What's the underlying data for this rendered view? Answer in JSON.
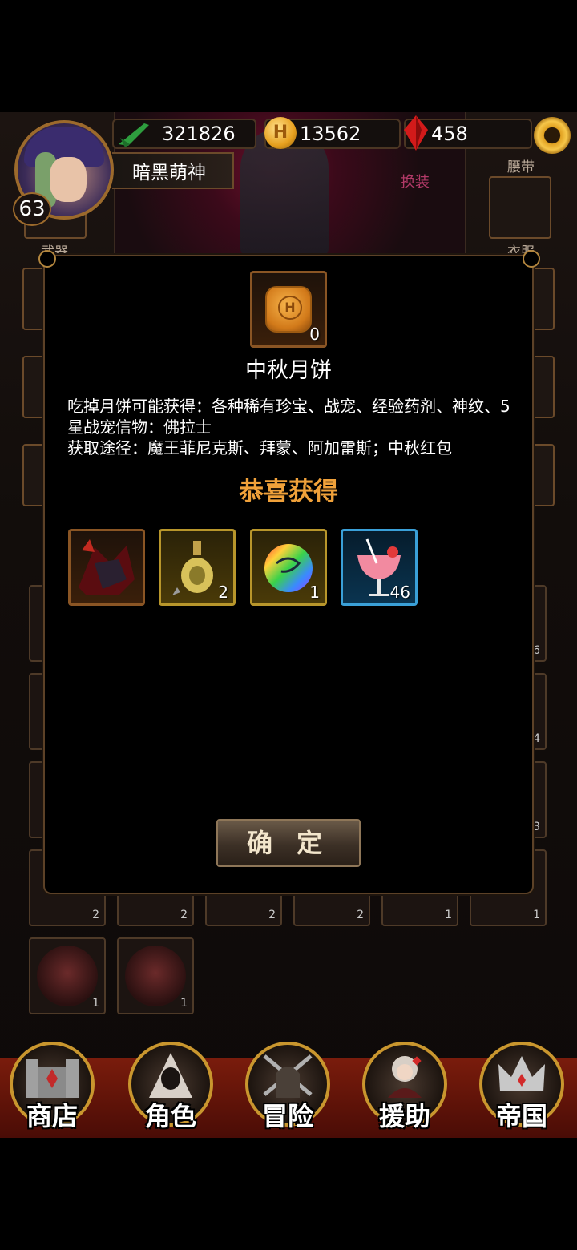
{
  "hud": {
    "power": "321826",
    "gold": "13562",
    "gems": "458",
    "player_name": "暗黑萌神",
    "level": "63",
    "equip_change_label": "换装"
  },
  "equip_labels": {
    "belt": "腰带",
    "weapon": "武器",
    "clothes": "衣服"
  },
  "background_counts": [
    "6",
    "4",
    "3",
    "2",
    "2",
    "2",
    "2",
    "1",
    "1",
    "1",
    "1"
  ],
  "modal": {
    "item_count": "0",
    "item_name": "中秋月饼",
    "description_line1": "吃掉月饼可能获得：各种稀有珍宝、战宠、经验药剂、神纹、5星战宠信物：佛拉士",
    "description_line2": "获取途径：魔王菲尼克斯、拜蒙、阿加雷斯；中秋红包",
    "congrats": "恭喜获得",
    "rewards": [
      {
        "icon": "dark-pet-icon",
        "count": ""
      },
      {
        "icon": "potion-vase-icon",
        "count": "2"
      },
      {
        "icon": "rainbow-orb-icon",
        "count": "1"
      },
      {
        "icon": "cocktail-icon",
        "count": "46"
      }
    ],
    "confirm_label": "确定"
  },
  "nav": {
    "shop": "商店",
    "character": "角色",
    "adventure": "冒险",
    "support": "援助",
    "empire": "帝国"
  },
  "colors": {
    "congrats": "#f0a13a",
    "frame_bronze": "#8a5524",
    "frame_gold": "#b8962b",
    "frame_blue": "#3aa0d8"
  }
}
